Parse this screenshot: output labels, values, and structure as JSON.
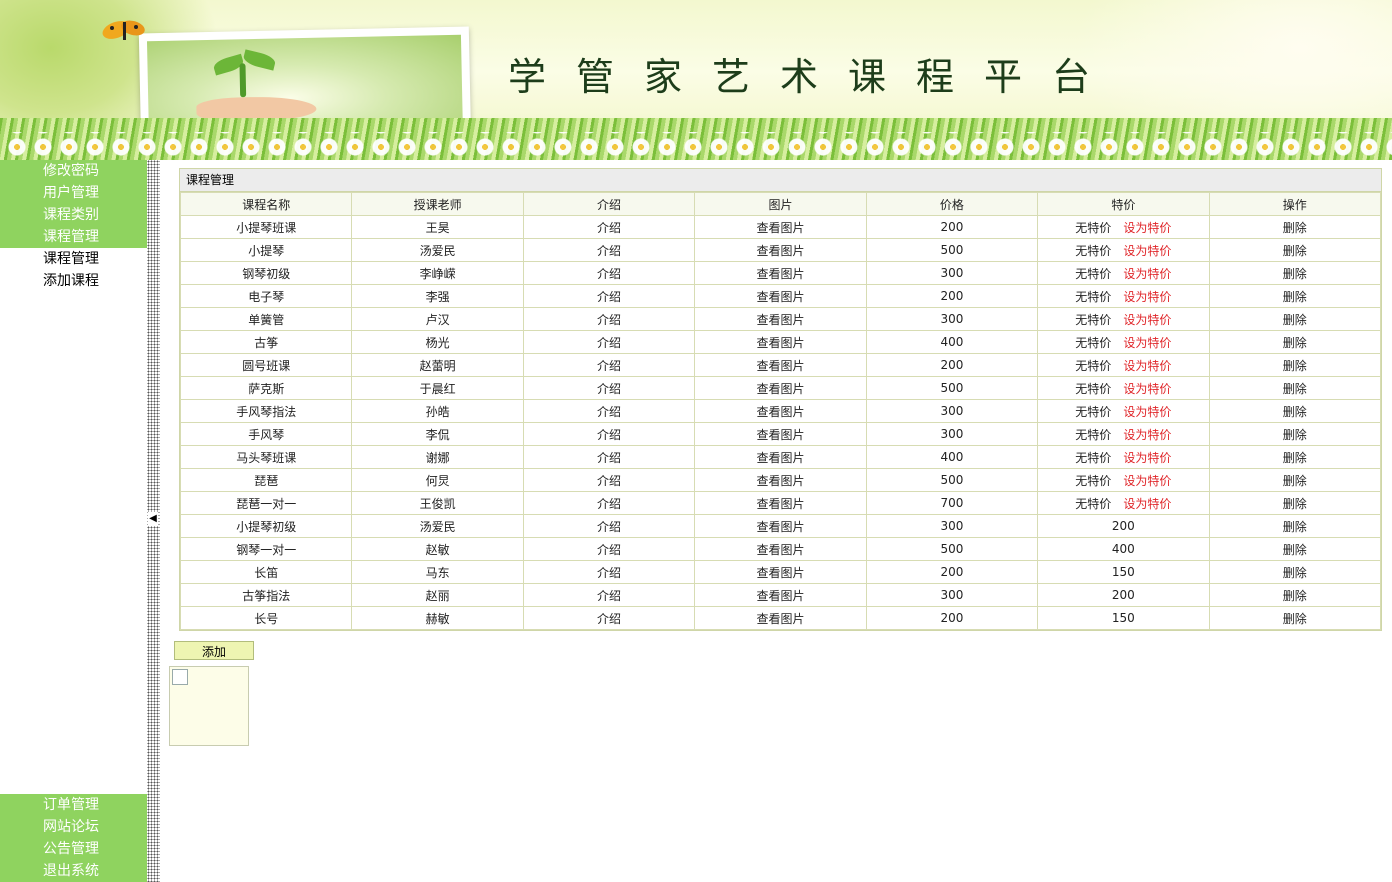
{
  "header": {
    "title": "学管家艺术课程平台"
  },
  "sidebar": {
    "top_items": [
      "修改密码",
      "用户管理",
      "课程类别",
      "课程管理"
    ],
    "sub_items": [
      "课程管理",
      "添加课程"
    ],
    "bottom_items": [
      "订单管理",
      "网站论坛",
      "公告管理",
      "退出系统"
    ]
  },
  "panel": {
    "title": "课程管理",
    "columns": [
      "课程名称",
      "授课老师",
      "介绍",
      "图片",
      "价格",
      "特价",
      "操作"
    ],
    "rows": [
      {
        "name": "小提琴班课",
        "teacher": "王昊",
        "intro": "介绍",
        "image": "查看图片",
        "price": "200",
        "special": "无特价",
        "set_special": "设为特价",
        "action": "删除"
      },
      {
        "name": "小提琴",
        "teacher": "汤爱民",
        "intro": "介绍",
        "image": "查看图片",
        "price": "500",
        "special": "无特价",
        "set_special": "设为特价",
        "action": "删除"
      },
      {
        "name": "钢琴初级",
        "teacher": "李峥嵘",
        "intro": "介绍",
        "image": "查看图片",
        "price": "300",
        "special": "无特价",
        "set_special": "设为特价",
        "action": "删除"
      },
      {
        "name": "电子琴",
        "teacher": "李强",
        "intro": "介绍",
        "image": "查看图片",
        "price": "200",
        "special": "无特价",
        "set_special": "设为特价",
        "action": "删除"
      },
      {
        "name": "单簧管",
        "teacher": "卢汉",
        "intro": "介绍",
        "image": "查看图片",
        "price": "300",
        "special": "无特价",
        "set_special": "设为特价",
        "action": "删除"
      },
      {
        "name": "古筝",
        "teacher": "杨光",
        "intro": "介绍",
        "image": "查看图片",
        "price": "400",
        "special": "无特价",
        "set_special": "设为特价",
        "action": "删除"
      },
      {
        "name": "圆号班课",
        "teacher": "赵蕾明",
        "intro": "介绍",
        "image": "查看图片",
        "price": "200",
        "special": "无特价",
        "set_special": "设为特价",
        "action": "删除"
      },
      {
        "name": "萨克斯",
        "teacher": "于晨红",
        "intro": "介绍",
        "image": "查看图片",
        "price": "500",
        "special": "无特价",
        "set_special": "设为特价",
        "action": "删除"
      },
      {
        "name": "手风琴指法",
        "teacher": "孙皓",
        "intro": "介绍",
        "image": "查看图片",
        "price": "300",
        "special": "无特价",
        "set_special": "设为特价",
        "action": "删除"
      },
      {
        "name": "手风琴",
        "teacher": "李侃",
        "intro": "介绍",
        "image": "查看图片",
        "price": "300",
        "special": "无特价",
        "set_special": "设为特价",
        "action": "删除"
      },
      {
        "name": "马头琴班课",
        "teacher": "谢娜",
        "intro": "介绍",
        "image": "查看图片",
        "price": "400",
        "special": "无特价",
        "set_special": "设为特价",
        "action": "删除"
      },
      {
        "name": "琵琶",
        "teacher": "何炅",
        "intro": "介绍",
        "image": "查看图片",
        "price": "500",
        "special": "无特价",
        "set_special": "设为特价",
        "action": "删除"
      },
      {
        "name": "琵琶一对一",
        "teacher": "王俊凯",
        "intro": "介绍",
        "image": "查看图片",
        "price": "700",
        "special": "无特价",
        "set_special": "设为特价",
        "action": "删除"
      },
      {
        "name": "小提琴初级",
        "teacher": "汤爱民",
        "intro": "介绍",
        "image": "查看图片",
        "price": "300",
        "special": "200",
        "set_special": "",
        "action": "删除"
      },
      {
        "name": "钢琴一对一",
        "teacher": "赵敏",
        "intro": "介绍",
        "image": "查看图片",
        "price": "500",
        "special": "400",
        "set_special": "",
        "action": "删除"
      },
      {
        "name": "长笛",
        "teacher": "马东",
        "intro": "介绍",
        "image": "查看图片",
        "price": "200",
        "special": "150",
        "set_special": "",
        "action": "删除"
      },
      {
        "name": "古筝指法",
        "teacher": "赵丽",
        "intro": "介绍",
        "image": "查看图片",
        "price": "300",
        "special": "200",
        "set_special": "",
        "action": "删除"
      },
      {
        "name": "长号",
        "teacher": "赫敏",
        "intro": "介绍",
        "image": "查看图片",
        "price": "200",
        "special": "150",
        "set_special": "",
        "action": "删除"
      }
    ]
  },
  "add_button": "添加",
  "toggle_glyph": "◀",
  "colors": {
    "nav_bg": "#8fd35f",
    "link_red": "#e0262a",
    "button_bg": "#eef5b2"
  }
}
